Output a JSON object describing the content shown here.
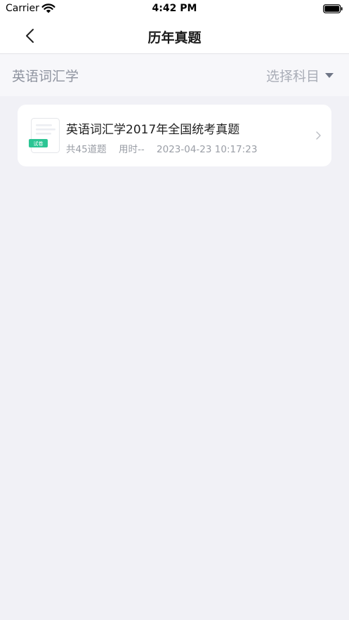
{
  "status_bar": {
    "carrier": "Carrier",
    "time": "4:42 PM"
  },
  "nav": {
    "title": "历年真题"
  },
  "filter": {
    "subject": "英语词汇学",
    "picker_label": "选择科目"
  },
  "exams": [
    {
      "title": "英语词汇学2017年全国统考真题",
      "badge": "试卷",
      "question_count": "共45道题",
      "duration": "用时--",
      "timestamp": "2023-04-23 10:17:23"
    }
  ],
  "colors": {
    "accent_green": "#2cc594",
    "background": "#f1f1f6",
    "card": "#ffffff"
  }
}
